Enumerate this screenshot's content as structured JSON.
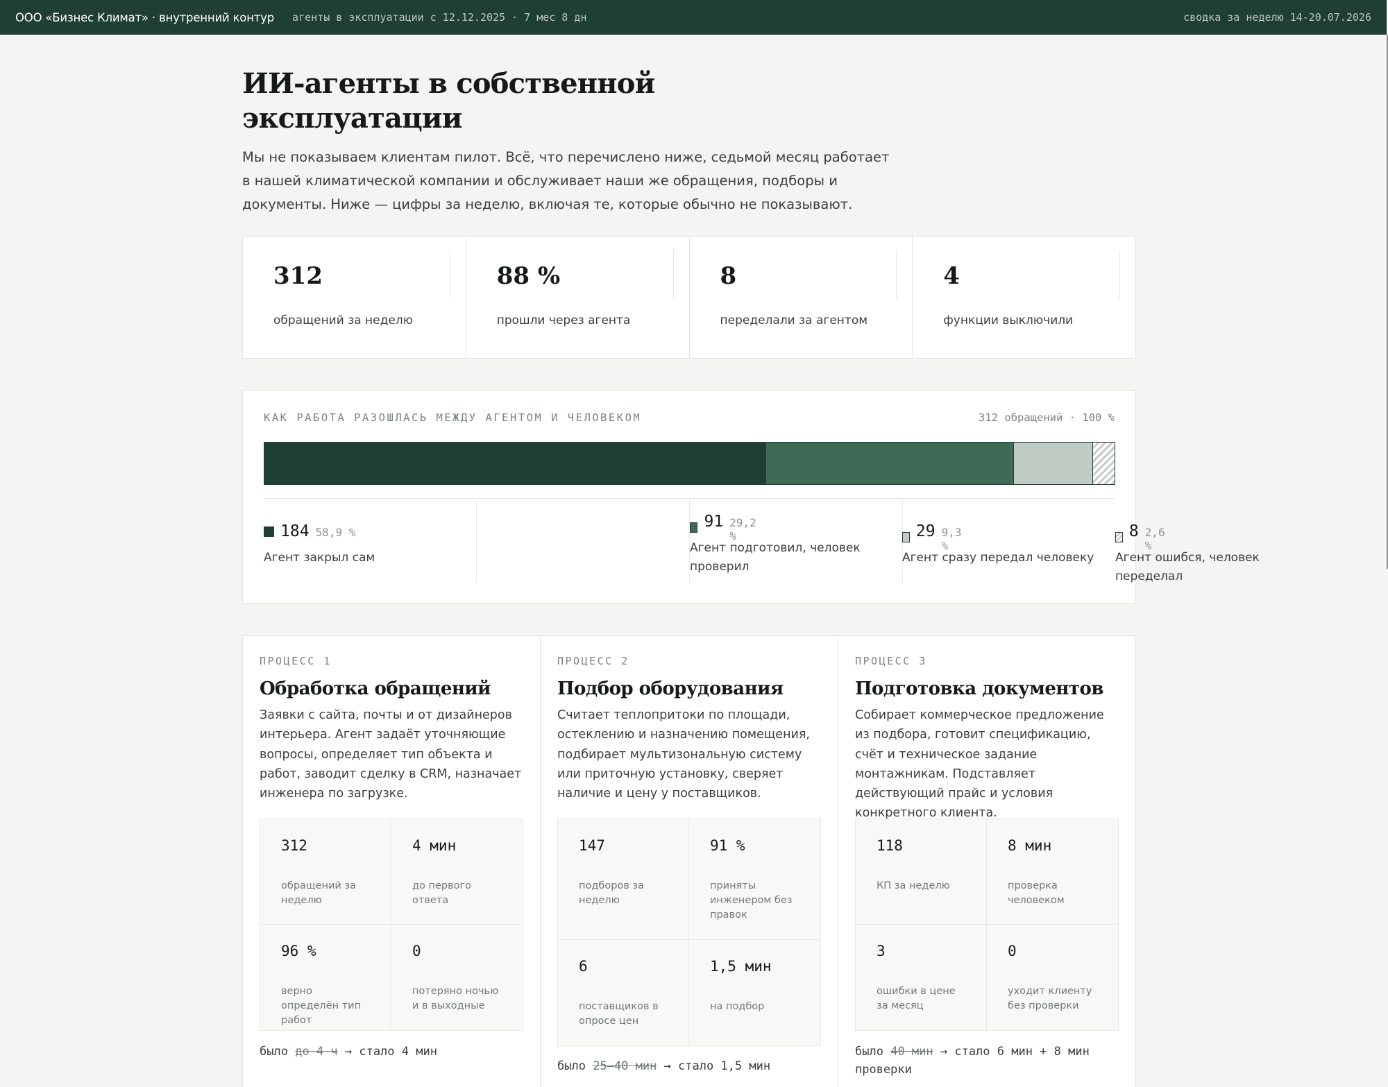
{
  "topbar": {
    "org": "ООО «Бизнес Климат» · внутренний контур",
    "since": "агенты в эксплуатации с 12.12.2025 · 7 мес 8 дн",
    "week": "сводка за неделю 14-20.07.2026"
  },
  "hero": {
    "title_line1": "ИИ-агенты в собственной",
    "title_line2": "эксплуатации",
    "lead": "Мы не показываем клиентам пилот. Всё, что перечислено ниже, седьмой месяц работает в нашей климатической компании и обслуживает наши же обращения, подборы и документы. Ниже — цифры за неделю, включая те, которые обычно не показывают."
  },
  "kpis": [
    {
      "value": "312",
      "label": "обращений за неделю"
    },
    {
      "value": "88 %",
      "label": "прошли через агента"
    },
    {
      "value": "8",
      "label": "переделали за агентом"
    },
    {
      "value": "4",
      "label": "функции выключили"
    }
  ],
  "split": {
    "caption": "КАК РАБОТА РАЗОШЛАСЬ МЕЖДУ АГЕНТОМ И ЧЕЛОВЕКОМ",
    "total": "312 обращений · 100 %",
    "segments": [
      {
        "count": "184",
        "share": 58.9,
        "pct": "58,9 %",
        "label": "Агент закрыл сам",
        "color": "#1f3f33"
      },
      {
        "count": "91",
        "share": 29.2,
        "pct": "29,2 %",
        "label": "Агент подготовил, человек проверил",
        "color": "#3e6b56"
      },
      {
        "count": "29",
        "share": 9.3,
        "pct": "9,3 %",
        "label": "Агент сразу передал человеку",
        "color": "#c3cbc5"
      },
      {
        "count": "8",
        "share": 2.6,
        "pct": "2,6 %",
        "label": "Агент ошибся, человек переделал",
        "color": "hatched"
      }
    ]
  },
  "processes": [
    {
      "tag": "ПРОЦЕСС 1",
      "title": "Обработка обращений",
      "desc": "Заявки с сайта, почты и от дизайнеров интерьера. Агент задаёт уточняющие вопросы, определяет тип объекта и работ, заводит сделку в CRM, назначает инженера по загрузке.",
      "metrics": [
        {
          "value": "312",
          "label": "обращений за неделю"
        },
        {
          "value": "4 мин",
          "label": "до первого ответа"
        },
        {
          "value": "96 %",
          "label": "верно определён тип работ"
        },
        {
          "value": "0",
          "label": "потеряно ночью и в выходные"
        }
      ],
      "foot": {
        "before": "было",
        "old": "до 4 ч",
        "after": "→ стало 4 мин"
      }
    },
    {
      "tag": "ПРОЦЕСС 2",
      "title": "Подбор оборудования",
      "desc": "Считает теплопритоки по площади, остеклению и назначению помещения, подбирает мультизональную систему или приточную установку, сверяет наличие и цену у поставщиков.",
      "metrics": [
        {
          "value": "147",
          "label": "подборов за неделю"
        },
        {
          "value": "91 %",
          "label": "приняты инженером без правок"
        },
        {
          "value": "6",
          "label": "поставщиков в опросе цен"
        },
        {
          "value": "1,5 мин",
          "label": "на подбор"
        }
      ],
      "foot": {
        "before": "было",
        "old": "25–40 мин",
        "after": "→ стало 1,5 мин"
      }
    },
    {
      "tag": "ПРОЦЕСС 3",
      "title": "Подготовка документов",
      "desc": "Собирает коммерческое предложение из подбора, готовит спецификацию, счёт и техническое задание монтажникам. Подставляет действующий прайс и условия конкретного клиента.",
      "metrics": [
        {
          "value": "118",
          "label": "КП за неделю"
        },
        {
          "value": "8 мин",
          "label": "проверка человеком"
        },
        {
          "value": "3",
          "label": "ошибки в цене за месяц"
        },
        {
          "value": "0",
          "label": "уходит клиенту без проверки"
        }
      ],
      "foot": {
        "before": "было",
        "old": "40 мин",
        "after": "→ стало 6 мин + 8 мин проверки"
      }
    }
  ]
}
